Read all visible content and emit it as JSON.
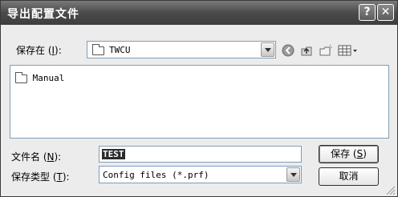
{
  "window": {
    "title": "导出配置文件",
    "help_glyph": "?",
    "close_glyph": "✕"
  },
  "location": {
    "label_prefix": "保存在 (",
    "label_key": "I",
    "label_suffix": "):",
    "current_folder": "TWCU"
  },
  "files": [
    {
      "name": "Manual",
      "type": "folder"
    }
  ],
  "filename": {
    "label_prefix": "文件名 (",
    "label_key": "N",
    "label_suffix": "):",
    "value": "TEST"
  },
  "filetype": {
    "label_prefix": "保存类型 (",
    "label_key": "T",
    "label_suffix": "):",
    "value": "Config files (*.prf)"
  },
  "buttons": {
    "save_prefix": "保存 (",
    "save_key": "S",
    "save_suffix": ")",
    "cancel": "取消"
  },
  "icons": {
    "back": "back-arrow-icon",
    "up": "up-folder-icon",
    "new_folder": "new-folder-icon",
    "view_menu": "view-menu-icon"
  }
}
